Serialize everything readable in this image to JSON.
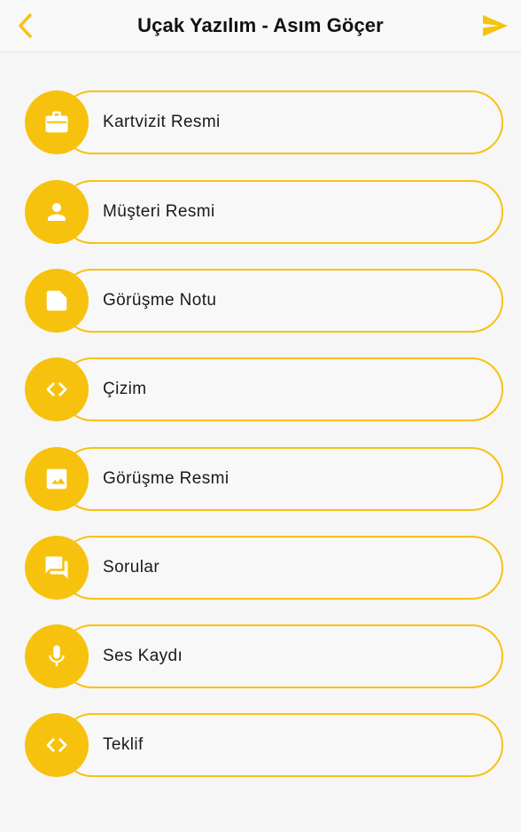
{
  "header": {
    "title": "Uçak Yazılım - Asım Göçer",
    "back_icon": "chevron-left-icon",
    "send_icon": "send-icon",
    "accent_color": "#F7C20E"
  },
  "menu": {
    "items": [
      {
        "label": "Kartvizit Resmi",
        "icon": "briefcase-icon"
      },
      {
        "label": "Müşteri Resmi",
        "icon": "person-icon"
      },
      {
        "label": "Görüşme Notu",
        "icon": "note-icon"
      },
      {
        "label": "Çizim",
        "icon": "code-icon"
      },
      {
        "label": "Görüşme Resmi",
        "icon": "image-icon"
      },
      {
        "label": "Sorular",
        "icon": "forum-icon"
      },
      {
        "label": "Ses Kaydı",
        "icon": "microphone-icon"
      },
      {
        "label": "Teklif",
        "icon": "code-icon"
      }
    ]
  }
}
